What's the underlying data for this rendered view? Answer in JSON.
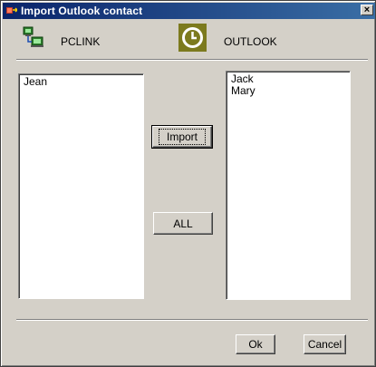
{
  "window": {
    "title": "Import Outlook contact",
    "close_label": "×"
  },
  "header": {
    "left_label": "PCLINK",
    "right_label": "OUTLOOK"
  },
  "lists": {
    "pclink_items": [
      "Jean"
    ],
    "outlook_items": [
      "Jack",
      "Mary"
    ]
  },
  "buttons": {
    "import_label": "Import",
    "all_label": "ALL",
    "ok_label": "Ok",
    "cancel_label": "Cancel"
  },
  "colors": {
    "title_bar": "#0a246a",
    "dialog_bg": "#d4d0c8",
    "outlook_icon": "#7c7a1e"
  }
}
